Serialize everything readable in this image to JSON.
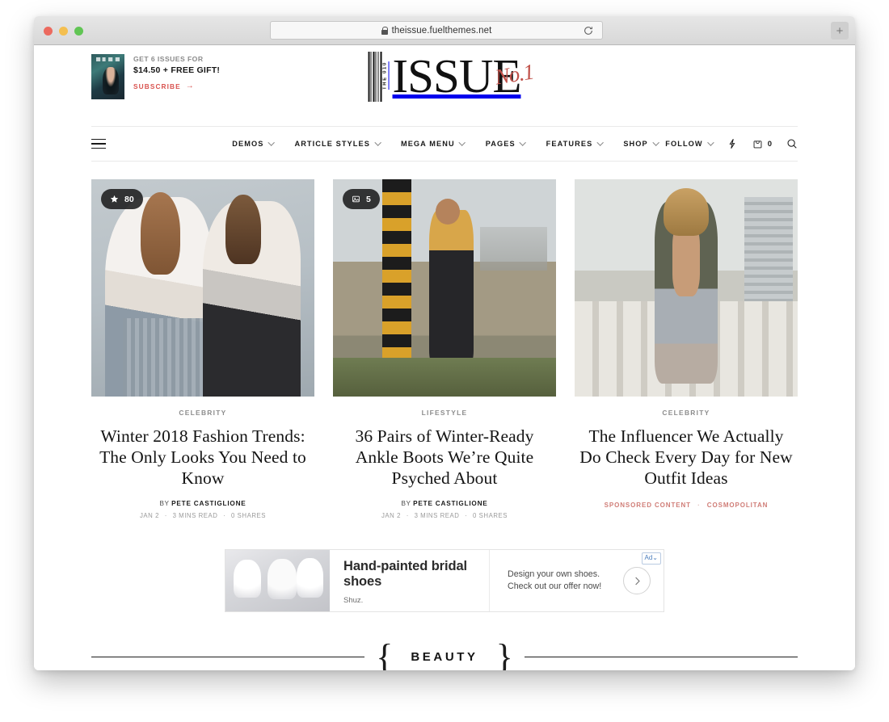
{
  "browser": {
    "url": "theissue.fuelthemes.net",
    "lock_icon": "lock-icon",
    "reload_icon": "reload-icon",
    "newtab_label": "+",
    "traffic_lights": [
      "close",
      "minimize",
      "zoom"
    ]
  },
  "promo": {
    "line1": "GET 6 ISSUES FOR",
    "line2": "$14.50 + FREE GIFT!",
    "cta": "SUBSCRIBE",
    "cta_arrow": "→",
    "accent_color": "#d9534f",
    "cover_alt": "magazine-cover-thumbnail"
  },
  "logo": {
    "word": "ISSUE",
    "script": "No.1",
    "barcode_label": "THE 010",
    "script_color": "#c0514a"
  },
  "nav": {
    "menu_icon": "hamburger-menu-icon",
    "items": [
      {
        "label": "DEMOS",
        "has_dropdown": true
      },
      {
        "label": "ARTICLE STYLES",
        "has_dropdown": true
      },
      {
        "label": "MEGA MENU",
        "has_dropdown": true
      },
      {
        "label": "PAGES",
        "has_dropdown": true
      },
      {
        "label": "FEATURES",
        "has_dropdown": true
      },
      {
        "label": "SHOP",
        "has_dropdown": true
      }
    ],
    "follow": {
      "label": "FOLLOW",
      "has_dropdown": true
    },
    "icons": {
      "bolt": "lightning-bolt-icon",
      "bag": "shopping-bag-icon",
      "bag_count": "0",
      "search": "search-icon"
    }
  },
  "articles": [
    {
      "badge": {
        "icon": "star-icon",
        "value": "80"
      },
      "category": "CELEBRITY",
      "title": "Winter 2018 Fashion Trends: The Only Looks You Need to Know",
      "author_prefix": "BY",
      "author": "PETE CASTIGLIONE",
      "date": "JAN 2",
      "read_time": "3 MINS READ",
      "shares": "0 SHARES",
      "image_alt": "two-women-in-white-jackets"
    },
    {
      "badge": {
        "icon": "gallery-icon",
        "value": "5"
      },
      "category": "LIFESTYLE",
      "title": "36 Pairs of Winter-Ready Ankle Boots We’re Quite Psyched About",
      "author_prefix": "BY",
      "author": "PETE CASTIGLIONE",
      "date": "JAN 2",
      "read_time": "3 MINS READ",
      "shares": "0 SHARES",
      "image_alt": "woman-leaning-on-striped-pole"
    },
    {
      "badge": null,
      "category": "CELEBRITY",
      "title": "The Influencer We Actually Do Check Every Day for New Outfit Ideas",
      "sponsored_label": "SPONSORED CONTENT",
      "sponsor_brand": "COSMOPOLITAN",
      "sponsor_color": "#d07d77",
      "image_alt": "woman-on-city-balcony"
    }
  ],
  "ad": {
    "headline": "Hand-painted bridal shoes",
    "brand": "Shuz.",
    "copy_line1": "Design your own shoes.",
    "copy_line2": "Check out our offer now!",
    "label": "Ad",
    "label_caret": "⌄",
    "cta_icon": "chevron-right-icon",
    "image_alt": "white-bridal-shoes"
  },
  "section": {
    "title": "BEAUTY",
    "brace_left": "{",
    "brace_right": "}"
  },
  "peek_cards": [
    "card-1",
    "card-2",
    "card-3"
  ]
}
